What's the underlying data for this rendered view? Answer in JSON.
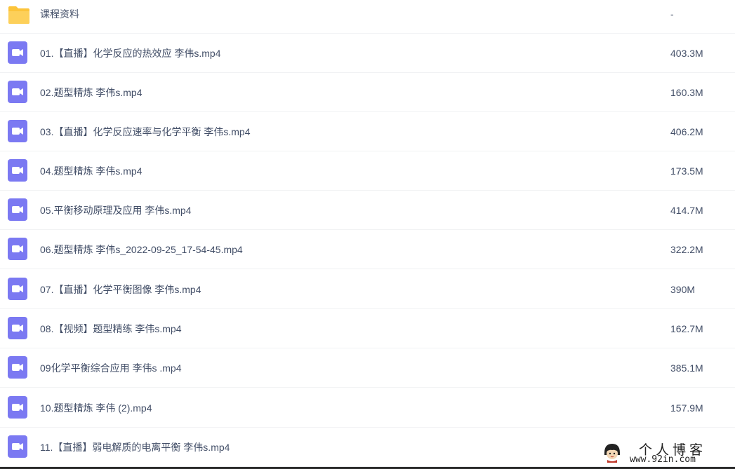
{
  "files": [
    {
      "type": "folder",
      "name": "课程资料",
      "size": "-"
    },
    {
      "type": "video",
      "name": "01.【直播】化学反应的热效应 李伟s.mp4",
      "size": "403.3M"
    },
    {
      "type": "video",
      "name": "02.题型精炼 李伟s.mp4",
      "size": "160.3M"
    },
    {
      "type": "video",
      "name": "03.【直播】化学反应速率与化学平衡 李伟s.mp4",
      "size": "406.2M"
    },
    {
      "type": "video",
      "name": "04.题型精炼 李伟s.mp4",
      "size": "173.5M"
    },
    {
      "type": "video",
      "name": "05.平衡移动原理及应用 李伟s.mp4",
      "size": "414.7M"
    },
    {
      "type": "video",
      "name": "06.题型精炼 李伟s_2022-09-25_17-54-45.mp4",
      "size": "322.2M"
    },
    {
      "type": "video",
      "name": "07.【直播】化学平衡图像 李伟s.mp4",
      "size": "390M"
    },
    {
      "type": "video",
      "name": "08.【视频】题型精练 李伟s.mp4",
      "size": "162.7M"
    },
    {
      "type": "video",
      "name": "09化学平衡综合应用 李伟s .mp4",
      "size": "385.1M"
    },
    {
      "type": "video",
      "name": "10.题型精炼 李伟 (2).mp4",
      "size": "157.9M"
    },
    {
      "type": "video",
      "name": "11.【直播】弱电解质的电离平衡 李伟s.mp4",
      "size": ""
    }
  ],
  "watermark": {
    "title": "个人博客",
    "url": "www.92in.com"
  },
  "colors": {
    "video_icon": "#7b79f2",
    "folder_icon": "#fcc43a",
    "text": "#424e67",
    "divider": "#f1f2f4"
  }
}
